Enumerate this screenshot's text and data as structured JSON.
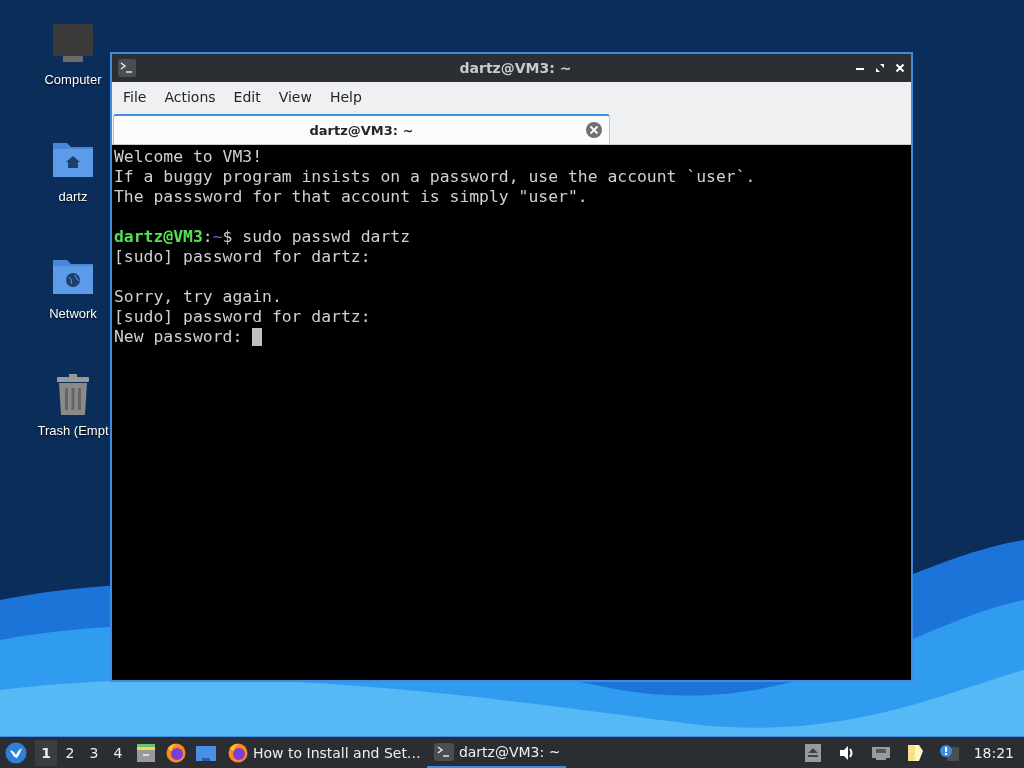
{
  "desktop_icons": [
    {
      "kind": "computer",
      "label": "Computer"
    },
    {
      "kind": "home",
      "label": "dartz"
    },
    {
      "kind": "network",
      "label": "Network"
    },
    {
      "kind": "trash",
      "label": "Trash (Empt"
    }
  ],
  "window": {
    "title": "dartz@VM3: ~",
    "active": true,
    "menu": [
      "File",
      "Actions",
      "Edit",
      "View",
      "Help"
    ],
    "tabs": [
      {
        "label": "dartz@VM3: ~",
        "selected": true
      }
    ],
    "terminal": {
      "lines": [
        {
          "kind": "text",
          "text": "Welcome to VM3!"
        },
        {
          "kind": "text",
          "text": "If a buggy program insists on a password, use the account `user`."
        },
        {
          "kind": "text",
          "text": "The passsword for that account is simply \"user\"."
        },
        {
          "kind": "blank"
        },
        {
          "kind": "prompt",
          "parts": [
            {
              "text": "dartz@VM3",
              "color": "#55e055"
            },
            {
              "text": ":",
              "color": "#d0d0d0"
            },
            {
              "text": "~",
              "color": "#5c6cff"
            },
            {
              "text": "$ sudo passwd dartz",
              "color": "#d0d0d0"
            }
          ]
        },
        {
          "kind": "text",
          "text": "[sudo] password for dartz:"
        },
        {
          "kind": "blank"
        },
        {
          "kind": "text",
          "text": "Sorry, try again."
        },
        {
          "kind": "text",
          "text": "[sudo] password for dartz:"
        },
        {
          "kind": "text",
          "text": "New password:",
          "cursor": true
        }
      ]
    }
  },
  "taskbar": {
    "workspaces": [
      {
        "label": "1",
        "selected": true
      },
      {
        "label": "2",
        "selected": false
      },
      {
        "label": "3",
        "selected": false
      },
      {
        "label": "4",
        "selected": false
      }
    ],
    "launchers": [
      {
        "kind": "files"
      },
      {
        "kind": "firefox"
      },
      {
        "kind": "desktop"
      }
    ],
    "tasks": [
      {
        "kind": "firefox",
        "label": "How to Install and Set…",
        "selected": false
      },
      {
        "kind": "terminal",
        "label": "dartz@VM3: ~",
        "selected": true
      }
    ],
    "tray": [
      {
        "kind": "eject"
      },
      {
        "kind": "volume"
      },
      {
        "kind": "network"
      },
      {
        "kind": "clipboard"
      },
      {
        "kind": "notification"
      }
    ],
    "clock": "18:21"
  }
}
